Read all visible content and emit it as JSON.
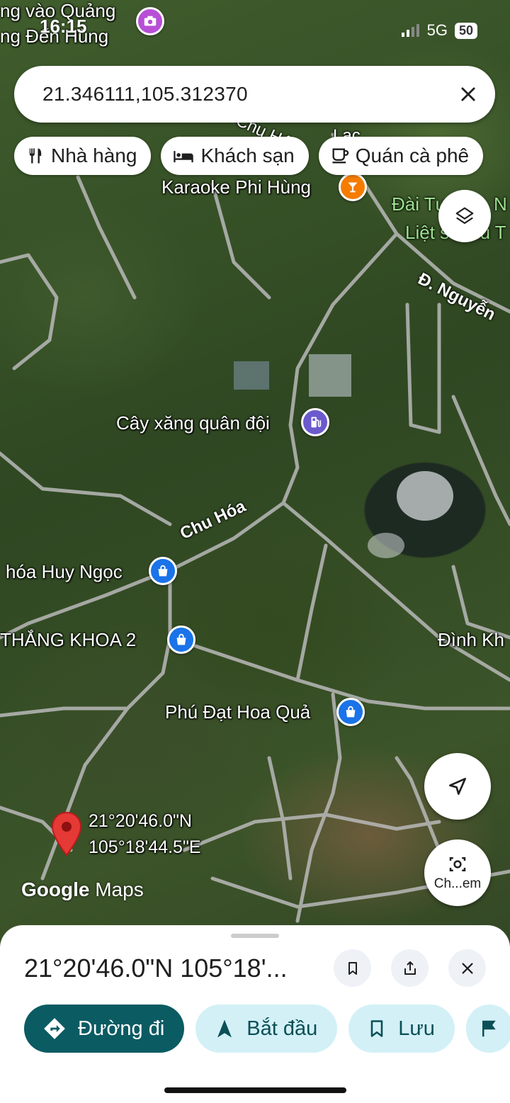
{
  "status_bar": {
    "time": "16:15",
    "network": "5G",
    "battery": "50"
  },
  "map_background_text": [
    "ng vào Quảng",
    "ng Đến Hùng"
  ],
  "search": {
    "value": "21.346111,105.312370"
  },
  "chips": [
    {
      "label": "Nhà hàng",
      "icon": "restaurant-icon"
    },
    {
      "label": "Khách sạn",
      "icon": "hotel-icon"
    },
    {
      "label": "Quán cà phê",
      "icon": "coffee-icon"
    }
  ],
  "map_labels": {
    "karaoke": "Karaoke Phi Hùng",
    "memorial_1": "Đài Tư",
    "memorial_2": "N",
    "memorial_3": "Liệt s",
    "memorial_4": "hú T",
    "road_nguyen": "Đ. Nguyễn",
    "road_top_1": "Chu Hóa",
    "road_top_2": "Lạc",
    "gas": "Cây xăng quân đội",
    "road_chu_hoa": "Chu Hóa",
    "huy_ngoc": "hóa Huy Ngọc",
    "thang_khoa": "THẮNG KHOA 2",
    "dinh_kh": "Đình Kh",
    "phu_dat": "Phú Đạt Hoa Quả",
    "pin_lat": "21°20'46.0\"N",
    "pin_lng": "105°18'44.5\"E"
  },
  "map_controls": {
    "camera_label": "Ch...em"
  },
  "watermark": {
    "google": "Google",
    "maps": "Maps"
  },
  "sheet": {
    "title": "21°20'46.0\"N 105°18'...",
    "buttons": {
      "directions": "Đường đi",
      "start": "Bắt đầu",
      "save": "Lưu"
    }
  },
  "colors": {
    "primary": "#0b5b63",
    "tonal": "#d3f0f7",
    "pin_red": "#e53935",
    "poi_blue": "#1a73e8",
    "poi_orange": "#f57c00",
    "poi_violet": "#6a5acd"
  }
}
